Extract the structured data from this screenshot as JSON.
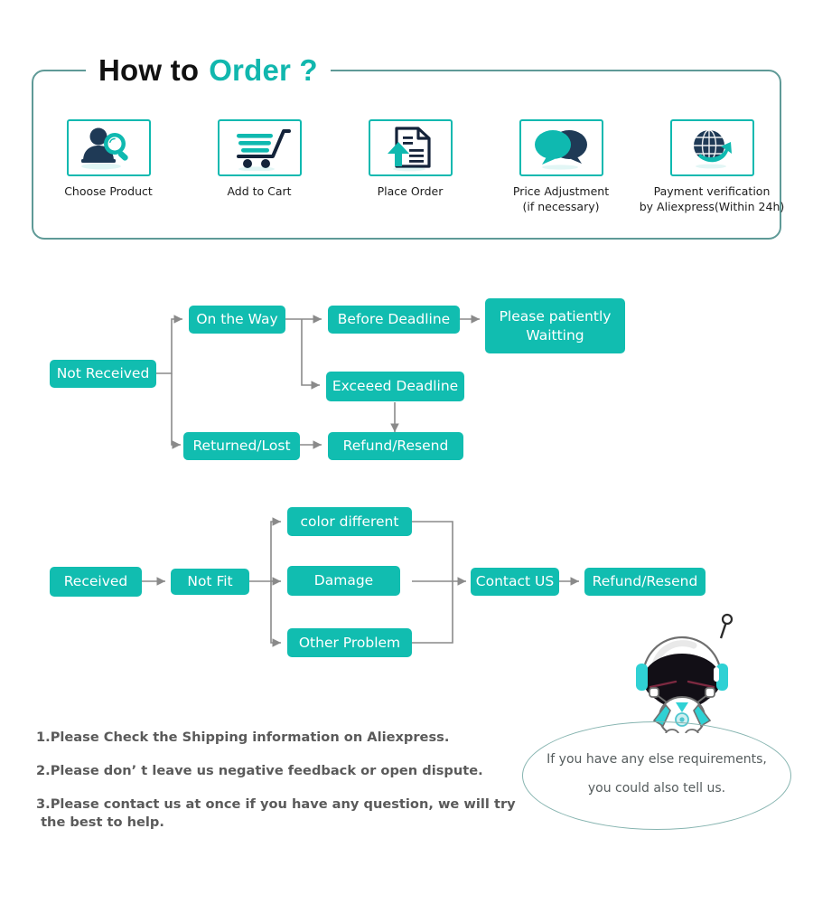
{
  "header": {
    "title_part1": "How to",
    "title_part2": "Order ?",
    "frame_color": "#5f9a97",
    "accent_color": "#11b7ae"
  },
  "steps": [
    {
      "icon": "person-search-icon",
      "label_line1": "Choose  Product",
      "label_line2": ""
    },
    {
      "icon": "shopping-cart-icon",
      "label_line1": "Add to Cart",
      "label_line2": ""
    },
    {
      "icon": "document-upload-icon",
      "label_line1": "Place  Order",
      "label_line2": ""
    },
    {
      "icon": "speech-bubbles-icon",
      "label_line1": "Price Adjustment",
      "label_line2": "(if necessary)"
    },
    {
      "icon": "globe-refresh-icon",
      "label_line1": "Payment verification",
      "label_line2": "by Aliexpress(Within 24h)"
    }
  ],
  "flow_not_received": {
    "nodes": [
      {
        "id": "not-received",
        "label": "Not Received"
      },
      {
        "id": "on-the-way",
        "label": "On the Way"
      },
      {
        "id": "returned-lost",
        "label": "Returned/Lost"
      },
      {
        "id": "before-deadline",
        "label": "Before Deadline"
      },
      {
        "id": "exceed-deadline",
        "label": "Exceeed Deadline"
      },
      {
        "id": "refund-resend",
        "label": "Refund/Resend"
      },
      {
        "id": "please-waiting",
        "label": "Please patiently Waitting"
      }
    ]
  },
  "flow_received": {
    "nodes": [
      {
        "id": "received",
        "label": "Received"
      },
      {
        "id": "not-fit",
        "label": "Not Fit"
      },
      {
        "id": "color-different",
        "label": "color different"
      },
      {
        "id": "damage",
        "label": "Damage"
      },
      {
        "id": "other-problem",
        "label": "Other Problem"
      },
      {
        "id": "contact-us",
        "label": "Contact US"
      },
      {
        "id": "refund-resend-2",
        "label": "Refund/Resend"
      }
    ]
  },
  "notes": [
    "1.Please Check the Shipping information on Aliexpress.",
    "2.Please don’ t leave us negative feedback or open dispute.",
    "3.Please contact us at once if you have any question, we will try\n the best to help."
  ],
  "bubble": {
    "line1": "If you have any else requirements,",
    "line2": "you could also tell us.",
    "border_color": "#86b4b0"
  },
  "colors": {
    "node_teal": "#11bdb0",
    "icon_navy": "#1f3a56",
    "icon_teal": "#0fb9b0",
    "wire_gray": "#8a8a8a",
    "note_gray": "#5a5a5a"
  }
}
